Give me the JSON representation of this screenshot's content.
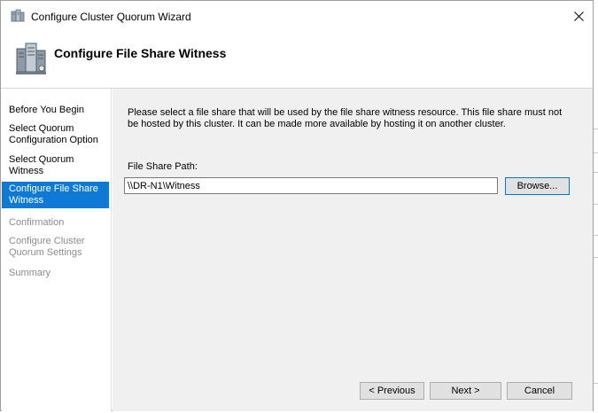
{
  "window": {
    "title": "Configure Cluster Quorum Wizard",
    "close_glyph": "✕"
  },
  "header": {
    "title": "Configure File Share Witness",
    "icon": "cluster-servers-icon"
  },
  "sidebar": {
    "items": [
      {
        "label": "Before You Begin",
        "state": "normal"
      },
      {
        "label": "Select Quorum Configuration Option",
        "state": "normal"
      },
      {
        "label": "Select Quorum Witness",
        "state": "normal"
      },
      {
        "label": "Configure File Share Witness",
        "state": "selected"
      },
      {
        "label": "Confirmation",
        "state": "disabled"
      },
      {
        "label": "Configure Cluster Quorum Settings",
        "state": "disabled"
      },
      {
        "label": "Summary",
        "state": "disabled"
      }
    ]
  },
  "main": {
    "description": "Please select a file share that will be used by the file share witness resource.  This file share must not be hosted by this cluster.  It can be made more available by hosting it on another cluster.",
    "path_label": "File Share Path:",
    "path_value": "\\\\DR-N1\\Witness",
    "browse_label": "Browse..."
  },
  "footer": {
    "previous_label": "< Previous",
    "next_label": "Next >",
    "cancel_label": "Cancel"
  },
  "colors": {
    "selection": "#0f7ad6",
    "content_bg": "#f0f0f0",
    "disabled_text": "#8c8c8c"
  }
}
